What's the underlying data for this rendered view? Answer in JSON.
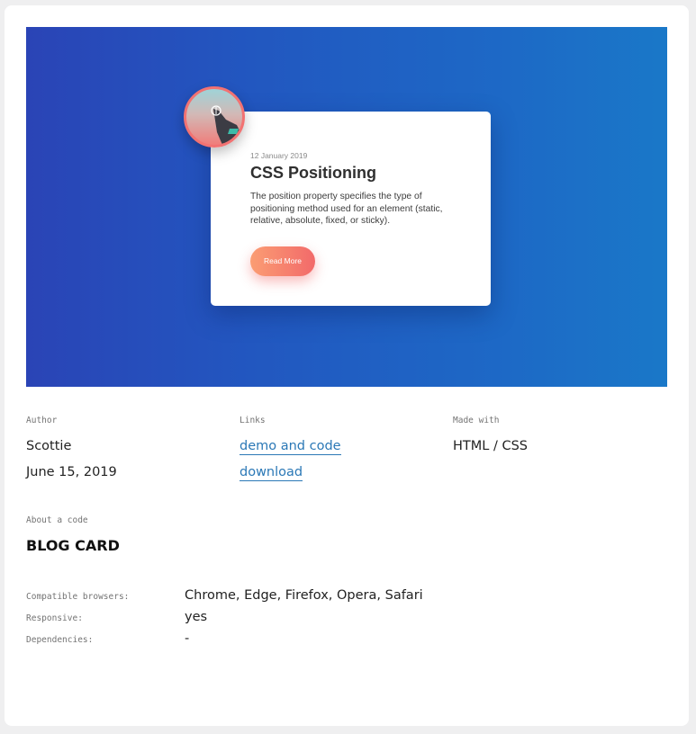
{
  "preview_card": {
    "date": "12 January 2019",
    "title": "CSS Positioning",
    "text": "The position property specifies the type of positioning method used for an element (static, relative, absolute, fixed, or sticky).",
    "button_label": "Read More"
  },
  "meta": {
    "author_label": "Author",
    "author_name": "Scottie",
    "date": "June 15, 2019",
    "links_label": "Links",
    "demo_link": "demo and code",
    "download_link": "download",
    "made_with_label": "Made with",
    "made_with": "HTML / CSS"
  },
  "about": {
    "label": "About a code",
    "title": "BLOG CARD"
  },
  "details": [
    {
      "label": "Compatible browsers:",
      "value": "Chrome, Edge, Firefox, Opera, Safari"
    },
    {
      "label": "Responsive:",
      "value": "yes"
    },
    {
      "label": "Dependencies:",
      "value": "-"
    }
  ],
  "colors": {
    "gradient_start": "#2a44b6",
    "gradient_end": "#1a78c8",
    "button_start": "#fb9d73",
    "button_end": "#f26a6a",
    "link": "#2b78b6"
  }
}
